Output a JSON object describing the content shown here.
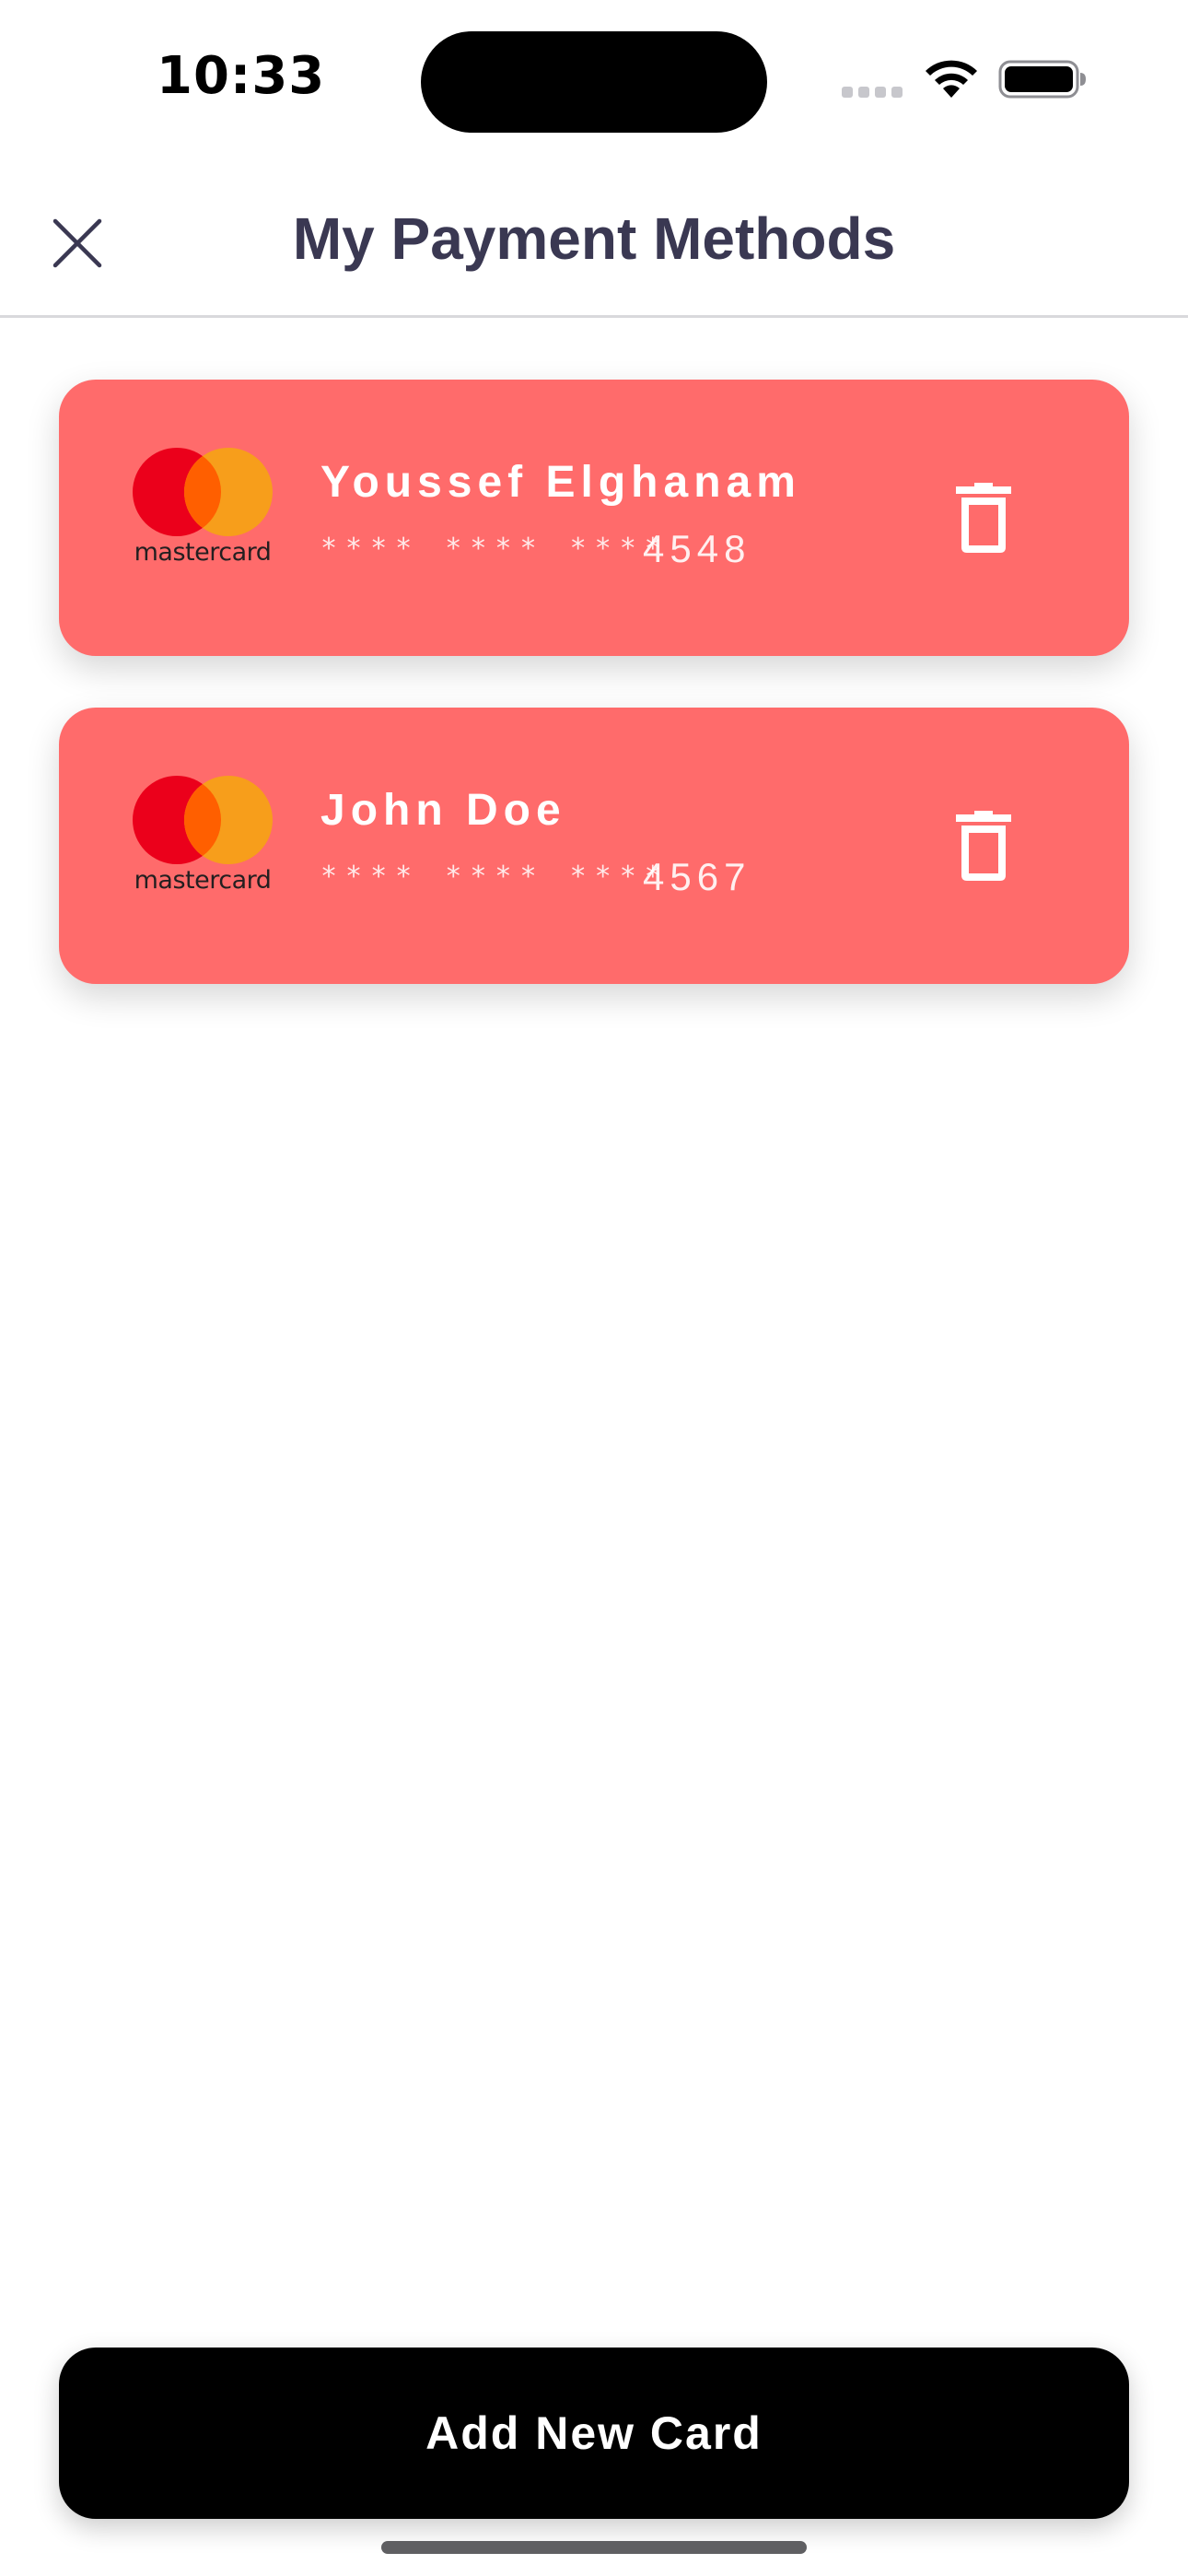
{
  "status_bar": {
    "time": "10:33",
    "signal_icon": "cellular-signal-icon",
    "wifi_icon": "wifi-icon",
    "battery_icon": "battery-icon"
  },
  "header": {
    "title": "My Payment Methods",
    "close_icon": "close-icon"
  },
  "cards": [
    {
      "brand": "mastercard",
      "holder": "Youssef Elghanam",
      "mask": "**** **** ****",
      "last4": "4548",
      "delete_icon": "trash-icon"
    },
    {
      "brand": "mastercard",
      "holder": "John Doe",
      "mask": "**** **** ****",
      "last4": "4567",
      "delete_icon": "trash-icon"
    }
  ],
  "footer": {
    "add_card_label": "Add New Card"
  },
  "colors": {
    "card_background": "#ff6b6b",
    "title_text": "#3a3852",
    "button_background": "#000000",
    "mastercard_red": "#eb001b",
    "mastercard_orange": "#ff5f00",
    "mastercard_yellow": "#f79e1b"
  }
}
